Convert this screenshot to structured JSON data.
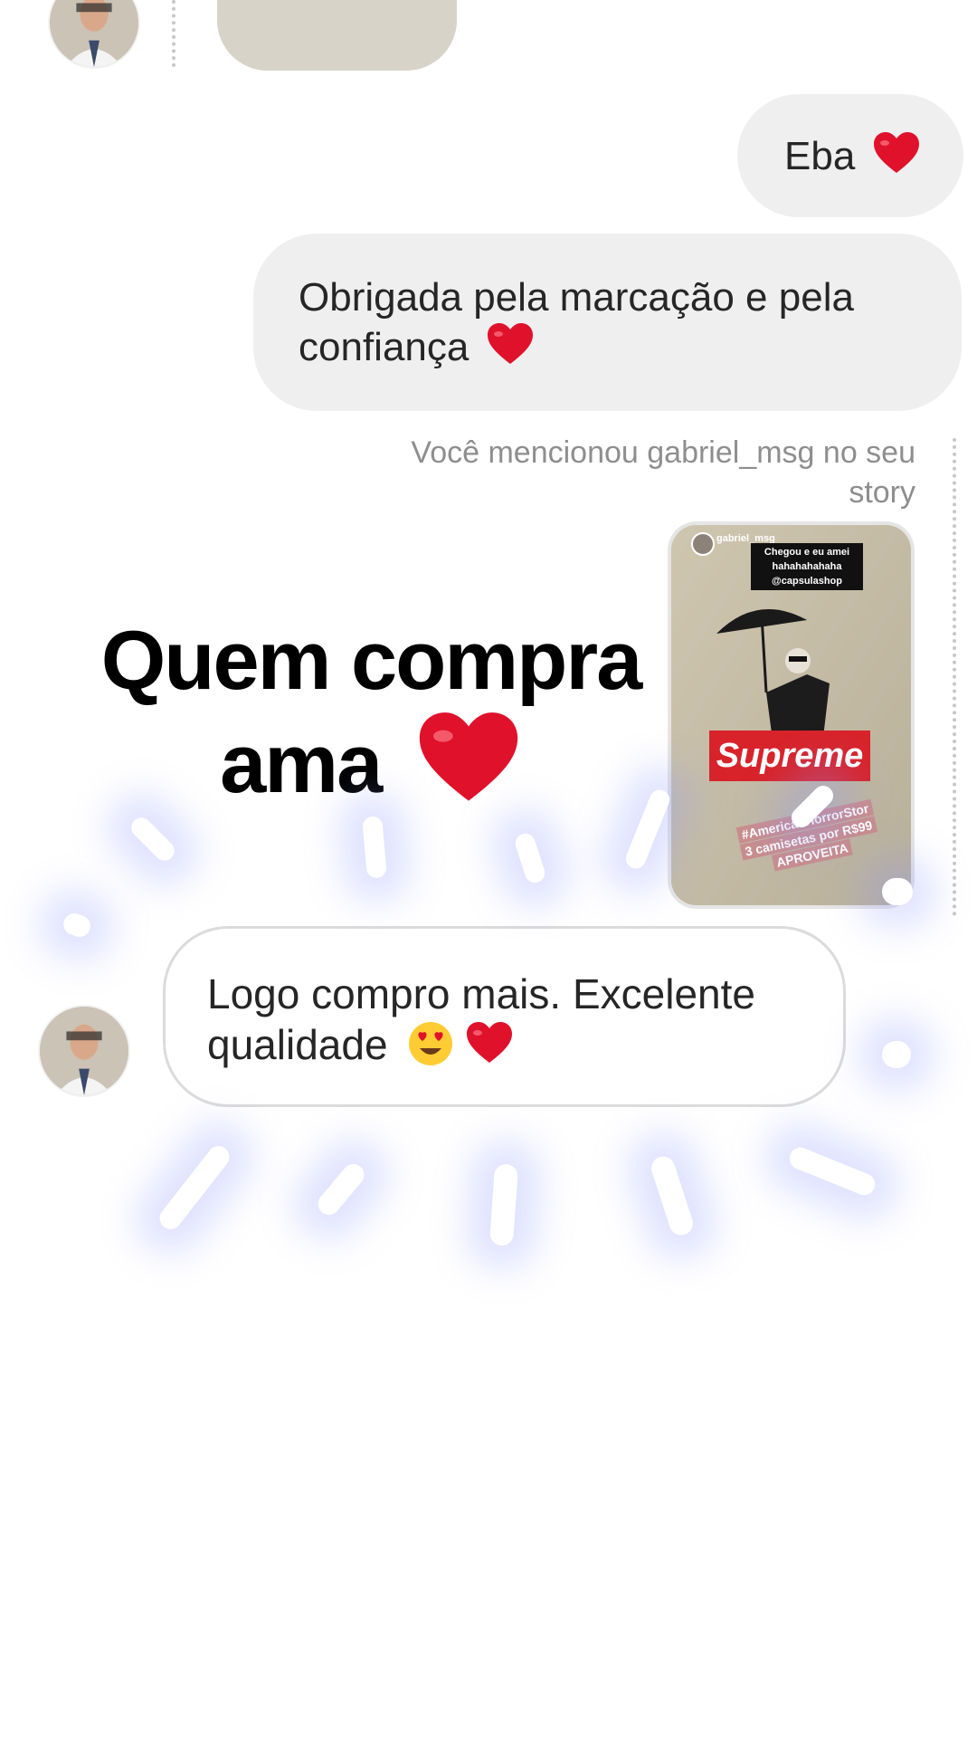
{
  "messages": {
    "eba": "Eba",
    "obrigada": "Obrigada pela marcação e pela confiança",
    "mention_notice": "Você mencionou gabriel_msg no seu story",
    "customer_reply": "Logo compro mais. Excelente qualidade"
  },
  "story": {
    "username": "gabriel_msg",
    "caption": "Chegou e eu amei hahahahahaha @capsulashop",
    "brand": "Supreme",
    "hashtag": "#AmericanHorrorStor",
    "promo_line1": "3 camisetas por R$99",
    "promo_line2": "APROVEITA"
  },
  "overlay": {
    "headline_line1": "Quem compra",
    "headline_line2": "ama"
  },
  "icons": {
    "heart": "heart-icon",
    "heart_eyes": "heart-eyes-emoji"
  },
  "colors": {
    "bubble_gray": "#efefef",
    "heart_red": "#e0112b",
    "supreme_red": "#d8232a",
    "glow": "#8c96ff"
  }
}
